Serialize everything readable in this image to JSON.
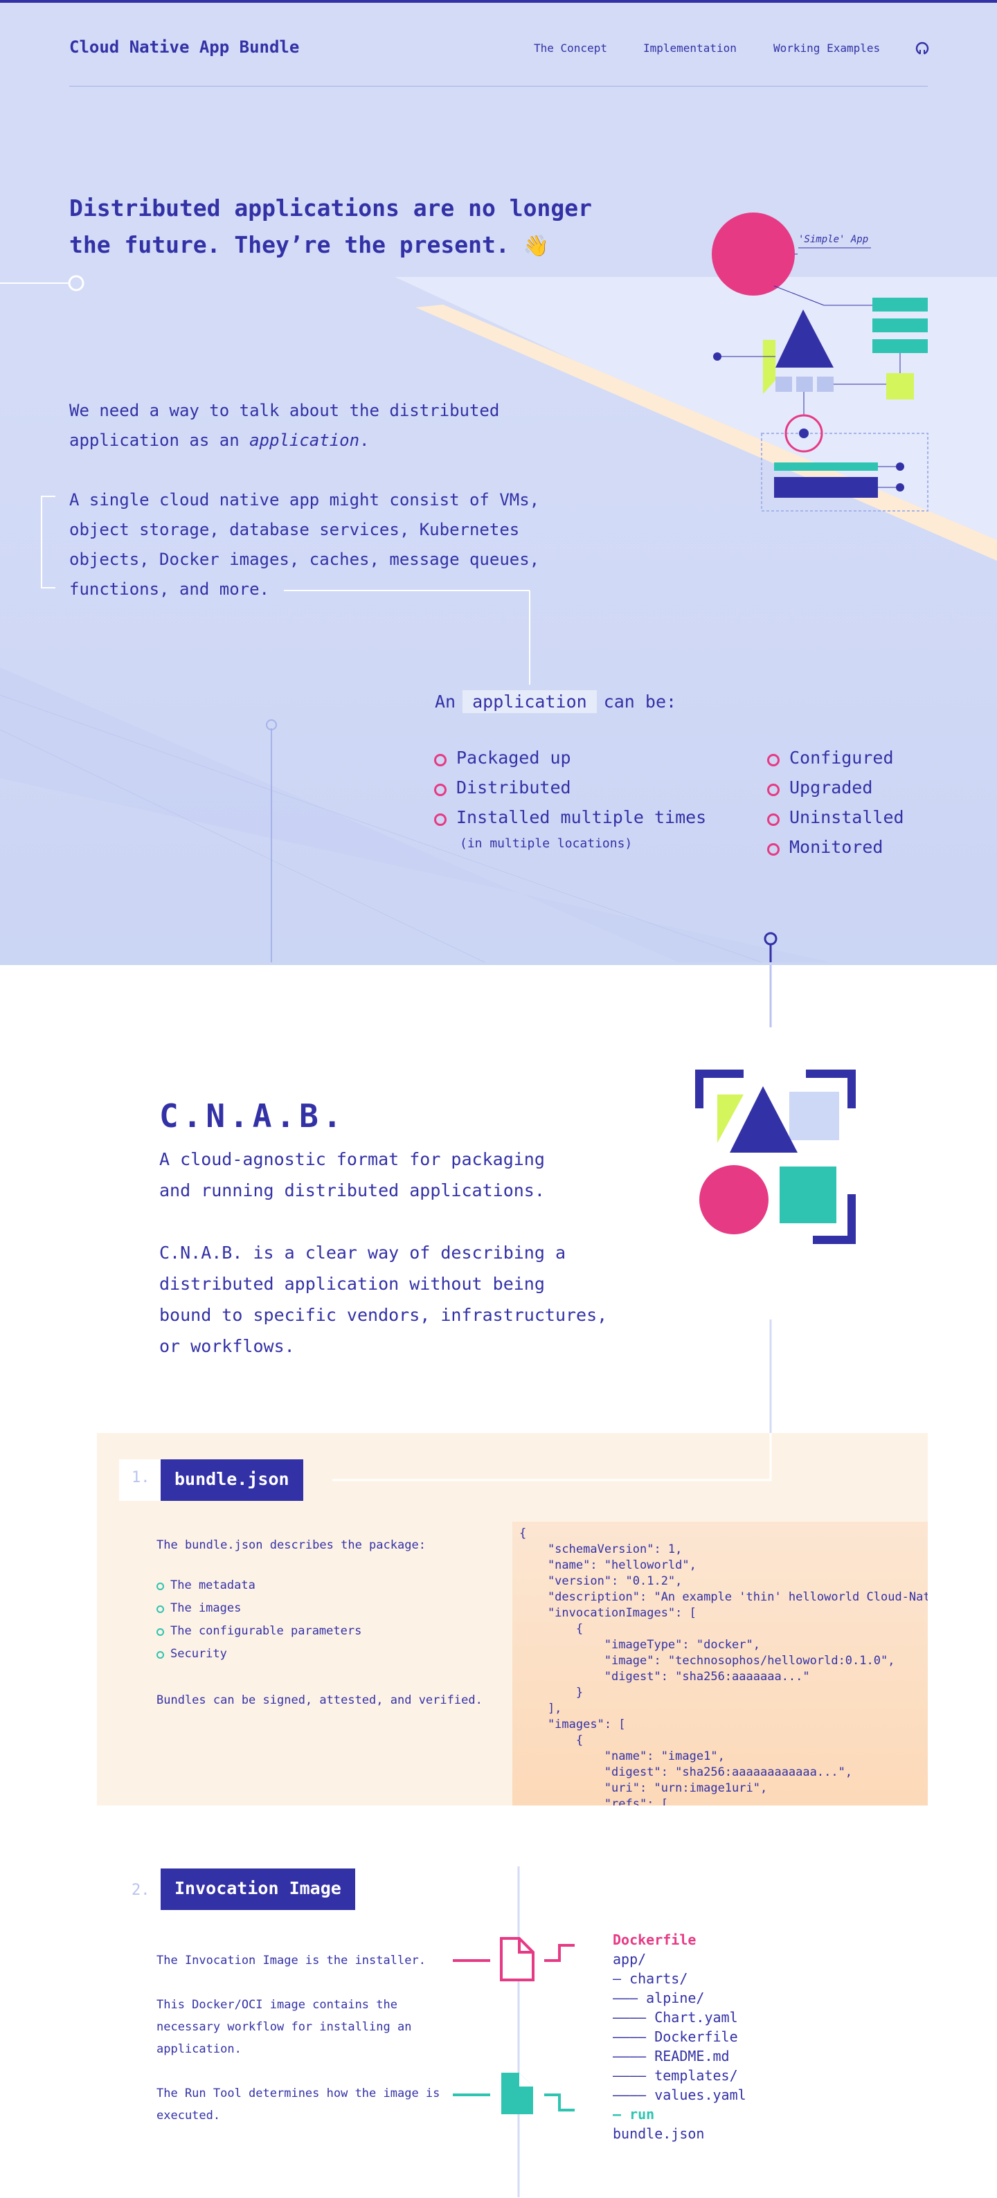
{
  "nav": {
    "brand": "Cloud Native App Bundle",
    "links": [
      "The Concept",
      "Implementation",
      "Working Examples"
    ],
    "github_icon": "github-icon"
  },
  "hero": {
    "headline_line1": "Distributed applications are no longer",
    "headline_line2": "the future. They’re the present.",
    "wave_emoji": "👋",
    "para1_line1": "We need a way to talk about the distributed",
    "para1_line2_prefix": "application as an ",
    "para1_line2_em": "application",
    "para1_line2_suffix": ".",
    "para2_lines": [
      "A single cloud native app might consist of VMs,",
      "object storage, database services, Kubernetes",
      "objects, Docker images, caches, message queues,",
      "functions, and more."
    ],
    "simple_app_label": "'Simple' App",
    "canbe_prefix": "An",
    "canbe_chip": "application",
    "canbe_suffix": "can be:",
    "list_left": [
      "Packaged up",
      "Distributed",
      "Installed multiple times"
    ],
    "list_left_sub": "(in multiple locations)",
    "list_right": [
      "Configured",
      "Upgraded",
      "Uninstalled",
      "Monitored"
    ]
  },
  "cnab": {
    "title": "C.N.A.B.",
    "tagline_lines": [
      "A cloud-agnostic format for packaging",
      "and running distributed applications."
    ],
    "desc_lines": [
      "C.N.A.B. is a clear way of describing a",
      "distributed application without being",
      "bound to specific vendors, infrastructures,",
      "or workflows."
    ]
  },
  "bundle": {
    "number": "1.",
    "title": "bundle.json",
    "intro": "The bundle.json describes the package:",
    "items": [
      "The metadata",
      "The images",
      "The configurable parameters",
      "Security"
    ],
    "footer": "Bundles can be signed, attested, and verified.",
    "code_lines": [
      "{",
      "    \"schemaVersion\": 1,",
      "    \"name\": \"helloworld\",",
      "    \"version\": \"0.1.2\",",
      "    \"description\": \"An example 'thin' helloworld Cloud-Native Application Bundle\",",
      "    \"invocationImages\": [",
      "        {",
      "            \"imageType\": \"docker\",",
      "            \"image\": \"technosophos/helloworld:0.1.0\",",
      "            \"digest\": \"sha256:aaaaaaa...\"",
      "        }",
      "    ],",
      "    \"images\": [",
      "        {",
      "            \"name\": \"image1\",",
      "            \"digest\": \"sha256:aaaaaaaaaaaa...\",",
      "            \"uri\": \"urn:image1uri\",",
      "            \"refs\": ["
    ]
  },
  "invocation": {
    "number": "2.",
    "title": "Invocation Image",
    "p1": "The Invocation Image is the installer.",
    "p2_lines": [
      "This Docker/OCI image contains the",
      "necessary workflow for installing an",
      "application."
    ],
    "p3_lines": [
      "The Run Tool determines how the image is",
      "executed."
    ],
    "tree": [
      {
        "text": "Dockerfile",
        "style": "pink"
      },
      {
        "text": "app/",
        "style": ""
      },
      {
        "text": "– charts/",
        "style": ""
      },
      {
        "text": "––– alpine/",
        "style": ""
      },
      {
        "text": "–––– Chart.yaml",
        "style": ""
      },
      {
        "text": "–––– Dockerfile",
        "style": ""
      },
      {
        "text": "–––– README.md",
        "style": ""
      },
      {
        "text": "–––– templates/",
        "style": ""
      },
      {
        "text": "–––– values.yaml",
        "style": ""
      },
      {
        "text": "– run",
        "style": "teal"
      },
      {
        "text": "bundle.json",
        "style": ""
      }
    ]
  },
  "colors": {
    "primary": "#3331a6",
    "pink": "#e63a84",
    "teal": "#2ec4b1",
    "lime": "#d4f55b",
    "hero_bg": "#d3dbf6",
    "peach": "#fdf2e6"
  }
}
